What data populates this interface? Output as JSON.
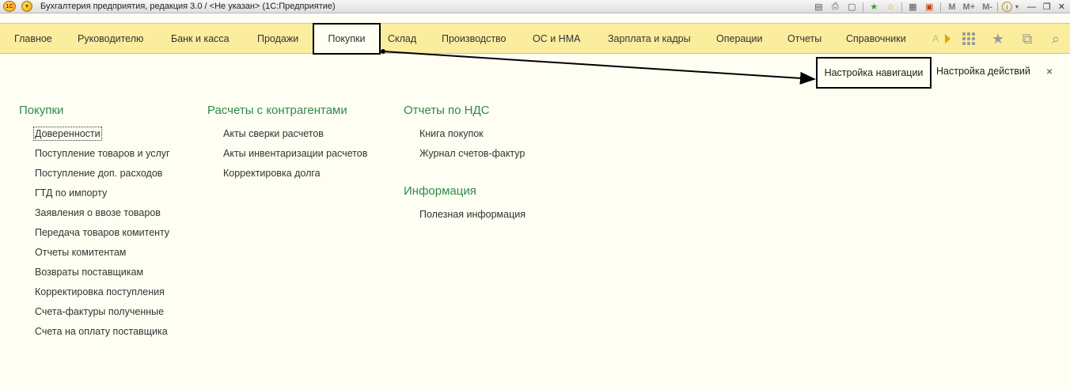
{
  "window": {
    "logo_text": "1С",
    "title": "Бухгалтерия предприятия, редакция 3.0 / <Не указан>  (1С:Предприятие)",
    "tools": {
      "m": "M",
      "m_plus": "M+",
      "m_minus": "M-",
      "info": "i"
    }
  },
  "sections": [
    {
      "label": "Главное"
    },
    {
      "label": "Руководителю"
    },
    {
      "label": "Банк и касса"
    },
    {
      "label": "Продажи"
    },
    {
      "label": "Покупки"
    },
    {
      "label": "Склад"
    },
    {
      "label": "Производство"
    },
    {
      "label": "ОС и НМА"
    },
    {
      "label": "Зарплата и кадры"
    },
    {
      "label": "Операции"
    },
    {
      "label": "Отчеты"
    },
    {
      "label": "Справочники"
    },
    {
      "label": "А"
    }
  ],
  "active_section": "Покупки",
  "panel": {
    "nav_settings": "Настройка навигации",
    "act_settings": "Настройка действий",
    "close": "×"
  },
  "groups": [
    {
      "title": "Покупки",
      "items": [
        "Доверенности",
        "Поступление товаров и услуг",
        "Поступление доп. расходов",
        "ГТД по импорту",
        "Заявления о ввозе товаров",
        "Передача товаров комитенту",
        "Отчеты комитентам",
        "Возвраты поставщикам",
        "Корректировка поступления",
        "Счета-фактуры полученные",
        "Счета на оплату поставщика"
      ]
    },
    {
      "title": "Расчеты с контрагентами",
      "items": [
        "Акты сверки расчетов",
        "Акты инвентаризации расчетов",
        "Корректировка долга"
      ]
    },
    {
      "title": "Отчеты по НДС",
      "items": [
        "Книга покупок",
        "Журнал счетов-фактур"
      ]
    },
    {
      "title": "Информация",
      "items": [
        "Полезная информация"
      ]
    }
  ],
  "colors": {
    "section_bar": "#fbed9e",
    "group_title": "#2e8a4a",
    "background": "#fefef2"
  }
}
